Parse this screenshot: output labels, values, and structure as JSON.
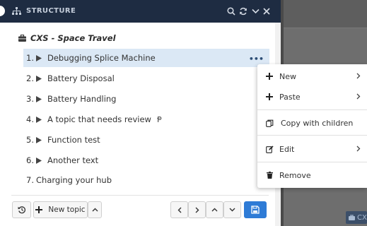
{
  "header": {
    "title": "STRUCTURE"
  },
  "tree": {
    "root_label": "CXS - Space Travel",
    "items": [
      {
        "num": "1.",
        "label": "Debugging Splice Machine",
        "expandable": true,
        "extra": ""
      },
      {
        "num": "2.",
        "label": "Battery Disposal",
        "expandable": true,
        "extra": ""
      },
      {
        "num": "3.",
        "label": "Battery Handling",
        "expandable": true,
        "extra": ""
      },
      {
        "num": "4.",
        "label": "A topic that needs review",
        "expandable": true,
        "extra": "Ᵽ"
      },
      {
        "num": "5.",
        "label": "Function test",
        "expandable": true,
        "extra": ""
      },
      {
        "num": "6.",
        "label": "Another text",
        "expandable": true,
        "extra": ""
      },
      {
        "num": "7.",
        "label": "Charging your hub",
        "expandable": false,
        "extra": ""
      }
    ],
    "row_menu": "•••"
  },
  "footer": {
    "new_topic_label": "New topic"
  },
  "context_menu": {
    "items": [
      {
        "label": "New",
        "icon": "plus-icon",
        "submenu": true
      },
      {
        "label": "Paste",
        "icon": "plus-icon",
        "submenu": true
      },
      {
        "label": "Copy with children",
        "icon": "copy-icon",
        "submenu": false
      },
      {
        "label": "Edit",
        "icon": "edit-icon",
        "submenu": true
      },
      {
        "label": "Remove",
        "icon": "trash-icon",
        "submenu": false
      }
    ]
  },
  "background": {
    "chip_text": "CX"
  },
  "colors": {
    "header_bg": "#1e2c42",
    "selected_row": "#dbe8f5",
    "primary": "#2e7bd6"
  }
}
